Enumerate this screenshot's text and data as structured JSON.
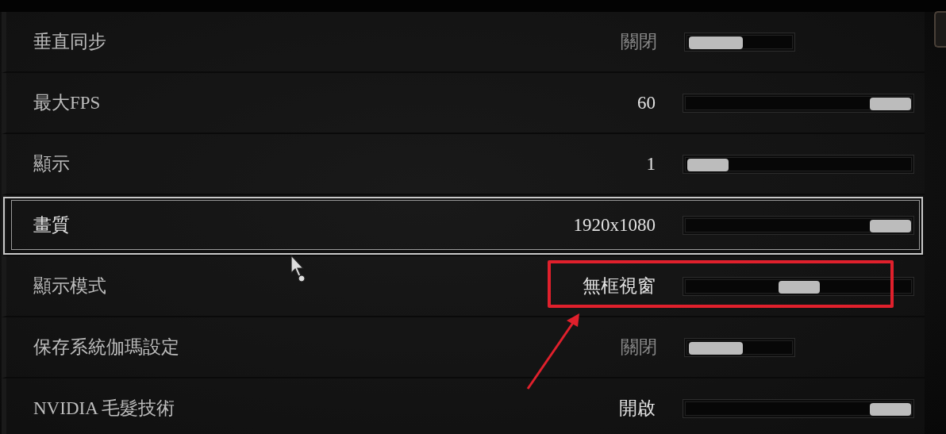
{
  "settings": [
    {
      "label": "垂直同步",
      "value": "關閉",
      "kind": "toggle",
      "on": false,
      "selected": false,
      "annotated": false
    },
    {
      "label": "最大FPS",
      "value": "60",
      "kind": "slider",
      "level": 1,
      "selected": false,
      "annotated": false
    },
    {
      "label": "顯示",
      "value": "1",
      "kind": "slider",
      "level": 0,
      "selected": false,
      "annotated": false
    },
    {
      "label": "畫質",
      "value": "1920x1080",
      "kind": "slider",
      "level": 1,
      "selected": true,
      "annotated": false
    },
    {
      "label": "顯示模式",
      "value": "無框視窗",
      "kind": "slider",
      "level": 0.5,
      "selected": false,
      "annotated": true
    },
    {
      "label": "保存系統伽瑪設定",
      "value": "關閉",
      "kind": "toggle",
      "on": false,
      "selected": false,
      "annotated": false
    },
    {
      "label": "NVIDIA 毛髮技術",
      "value": "開啟",
      "kind": "slider",
      "level": 1,
      "selected": false,
      "annotated": false
    }
  ]
}
